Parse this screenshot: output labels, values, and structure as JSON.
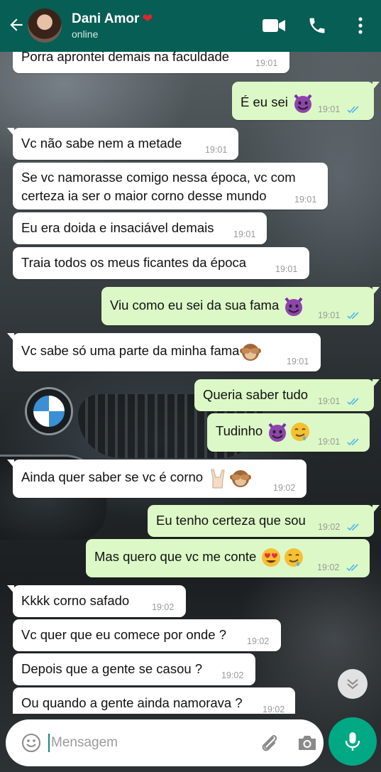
{
  "header": {
    "contact_name": "Dani Amor",
    "heart": "❤",
    "status": "online",
    "colors": {
      "bar": "#075e54",
      "accent": "#00a884"
    }
  },
  "messages": [
    {
      "dir": "in",
      "text": "Porra aprontei demais na faculdade",
      "time": "19:01"
    },
    {
      "dir": "out",
      "text": "É eu sei",
      "emoji": [
        "devil"
      ],
      "time": "19:01",
      "read": true
    },
    {
      "dir": "in",
      "text": "Vc não sabe nem a metade",
      "time": "19:01"
    },
    {
      "dir": "in",
      "text_line1": "Se vc namorasse comigo nessa época, vc com",
      "text_line2": "certeza ia ser o maior corno desse mundo",
      "time": "19:01"
    },
    {
      "dir": "in",
      "text": "Eu era doida e insaciável demais",
      "time": "19:01"
    },
    {
      "dir": "in",
      "text": "Traia todos os meus ficantes da época",
      "time": "19:01"
    },
    {
      "dir": "out",
      "text": "Viu como eu sei da sua fama",
      "emoji": [
        "devil"
      ],
      "time": "19:01",
      "read": true
    },
    {
      "dir": "in",
      "text": "Vc sabe só uma parte da minha fama",
      "emoji": [
        "monkey"
      ],
      "time": "19:01"
    },
    {
      "dir": "out",
      "text": "Queria saber tudo",
      "time": "19:01",
      "read": true
    },
    {
      "dir": "out",
      "text": "Tudinho",
      "emoji": [
        "devil",
        "drool"
      ],
      "time": "19:01",
      "read": true
    },
    {
      "dir": "in",
      "text": "Ainda quer saber se vc é corno",
      "emoji": [
        "horns-hand",
        "monkey"
      ],
      "time": "19:02"
    },
    {
      "dir": "out",
      "text": "Eu tenho certeza que sou",
      "time": "19:02",
      "read": true
    },
    {
      "dir": "out",
      "text": "Mas quero que vc me conte",
      "emoji": [
        "heart-eyes",
        "drool"
      ],
      "time": "19:02",
      "read": true
    },
    {
      "dir": "in",
      "text": "Kkkk corno safado",
      "time": "19:02"
    },
    {
      "dir": "in",
      "text": "Vc quer que eu comece por onde ?",
      "time": "19:02"
    },
    {
      "dir": "in",
      "text": "Depois que a gente se casou ?",
      "time": "19:02"
    },
    {
      "dir": "in",
      "text": "Ou quando a gente ainda namorava ?",
      "time": "19:02"
    }
  ],
  "composer": {
    "placeholder": "Mensagem",
    "value": ""
  },
  "icons": {
    "back": "arrow-left-icon",
    "video": "video-call-icon",
    "phone": "phone-icon",
    "menu": "more-vert-icon",
    "emoji": "emoji-icon",
    "attach": "paperclip-icon",
    "camera": "camera-icon",
    "mic": "microphone-icon",
    "scroll": "chevrons-down-icon"
  }
}
